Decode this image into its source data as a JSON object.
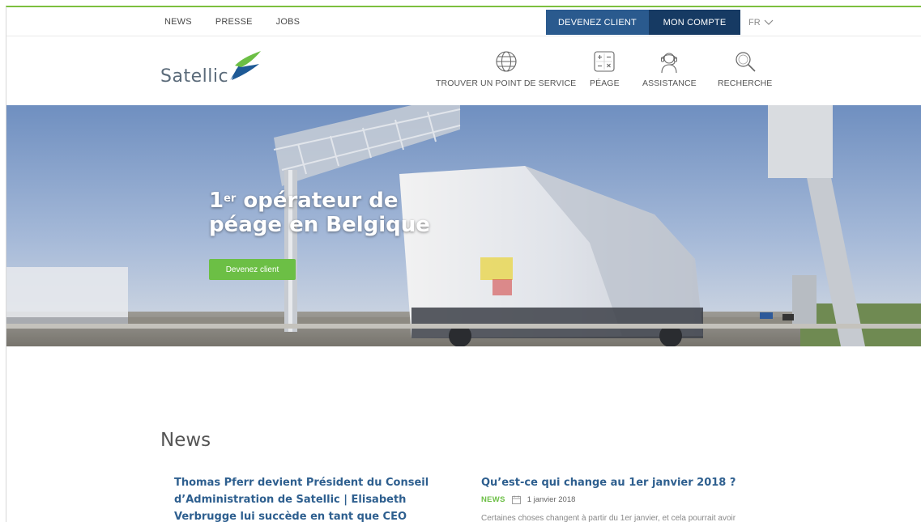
{
  "topbar": {
    "links": [
      "NEWS",
      "PRESSE",
      "JOBS"
    ],
    "become_client": "DEVENEZ CLIENT",
    "my_account": "MON COMPTE",
    "language": "FR"
  },
  "header": {
    "logo_text": "Satellic",
    "nav": [
      {
        "label": "TROUVER UN POINT DE SERVICE",
        "icon": "globe-icon"
      },
      {
        "label": "PÉAGE",
        "icon": "calculator-icon"
      },
      {
        "label": "ASSISTANCE",
        "icon": "headset-icon"
      },
      {
        "label": "RECHERCHE",
        "icon": "search-icon"
      }
    ]
  },
  "hero": {
    "title_prefix": "1",
    "title_sup": "er",
    "title_line1": " opérateur de",
    "title_line2": "péage en Belgique",
    "button": "Devenez client"
  },
  "news": {
    "heading": "News",
    "items": [
      {
        "title": "Thomas Pferr devient Président du Conseil d’Administration de Satellic | Elisabeth Verbrugge lui succède en tant que CEO"
      },
      {
        "title": "Qu’est-ce qui change au 1er janvier 2018 ?",
        "tag": "NEWS",
        "date": "1 janvier 2018",
        "excerpt": "Certaines choses changent à partir du 1er janvier, et cela pourrait avoir"
      }
    ]
  },
  "colors": {
    "accent_green": "#6cbf45",
    "blue_button": "#2a5a8e",
    "navy_button": "#163a63",
    "title_blue": "#2e5f8f"
  }
}
